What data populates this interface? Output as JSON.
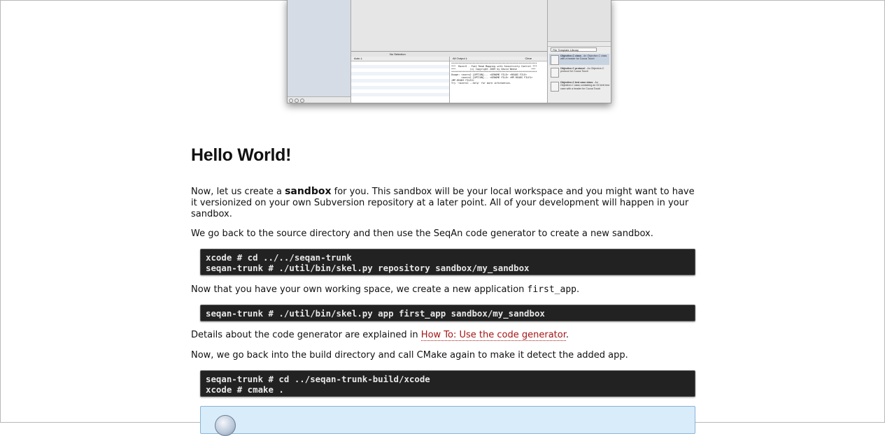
{
  "screenshot": {
    "debug_bar_label": "No Selection",
    "vars_header": "Auto ‡",
    "console_header": "All Output ‡",
    "console_clear": "Clear",
    "console_text": "************************************************************\n***  RazerS - Fast Read Mapping with Sensitivity Control ***\n***          (c) Copyright 2009 by David Weese          ***\n************************************************************\nUsage: razers2 [OPTION]... <GENOME FILE> <READS FILE>\n       razers2 [OPTION]... <GENOME FILE> <MP-READS FILE1>\n<MP-READS FILE2>\nTry 'razers2 --help' for more information.",
    "library_select": "File Template Library",
    "library_items": [
      {
        "title": "Objective-C class",
        "desc": " - An Objective-C class with a header for Cocoa Touch"
      },
      {
        "title": "Objective-C protocol",
        "desc": " - An Objective-C protocol for Cocoa Touch"
      },
      {
        "title": "Objective-C test case class",
        "desc": " - An Objective-C class containing an OCUnit test case with a header for Cocoa Touch"
      }
    ]
  },
  "article": {
    "title": "Hello World!",
    "p1_pre": "Now, let us create a ",
    "p1_bold": "sandbox",
    "p1_post": " for you. This sandbox will be your local workspace and you might want to have it versionized on your own Subversion repository at a later point. All of your development will happen in your sandbox.",
    "p2": "We go back to the source directory and then use the SeqAn code generator to create a new sandbox.",
    "code1": "xcode # cd ../../seqan-trunk\nseqan-trunk # ./util/bin/skel.py repository sandbox/my_sandbox",
    "p3_pre": "Now that you have your own working space, we create a new application ",
    "p3_code": "first_app",
    "p3_post": ".",
    "code2": "seqan-trunk # ./util/bin/skel.py app first_app sandbox/my_sandbox",
    "p4_pre": "Details about the code generator are explained in ",
    "p4_link": "How To: Use the code generator",
    "p4_post": ".",
    "p5": "Now, we go back into the build directory and call CMake again to make it detect the added app.",
    "code3": "seqan-trunk # cd ../seqan-trunk-build/xcode\nxcode # cmake ."
  }
}
